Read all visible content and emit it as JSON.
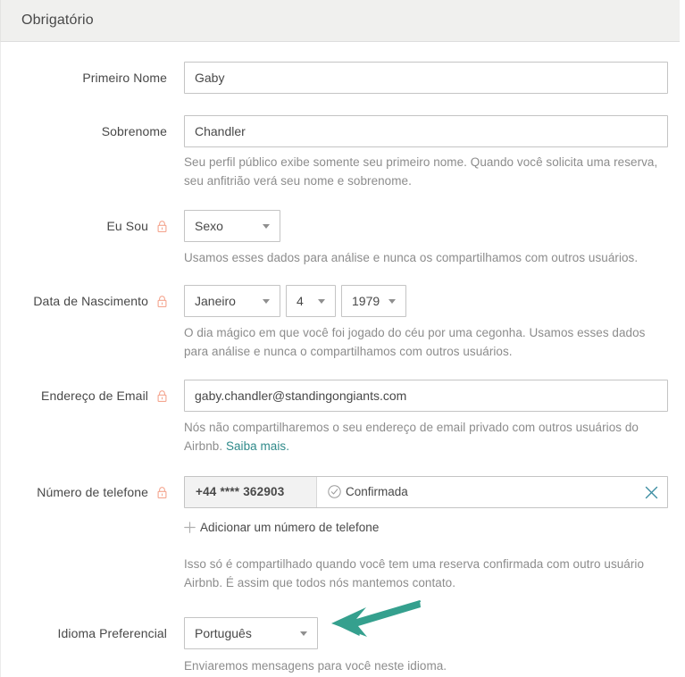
{
  "section": {
    "title": "Obrigatório"
  },
  "colors": {
    "header_bg": "#f0f0ee",
    "text": "#484848",
    "muted_text": "#8c8c8c",
    "link": "#2f8a8a",
    "lock_icon": "#f4a58f",
    "close_icon": "#3e8fa3",
    "annotation_arrow": "#35a08e",
    "input_border": "#c4c4c4"
  },
  "fields": {
    "first_name": {
      "label": "Primeiro Nome",
      "value": "Gaby",
      "locked": false
    },
    "last_name": {
      "label": "Sobrenome",
      "value": "Chandler",
      "locked": false,
      "help": "Seu perfil público exibe somente seu primeiro nome. Quando você solicita uma reserva, seu anfitrião verá seu nome e sobrenome."
    },
    "gender": {
      "label": "Eu Sou",
      "locked": true,
      "lock_icon": "lock-icon",
      "value": "Sexo",
      "help": "Usamos esses dados para análise e nunca os compartilhamos com outros usuários."
    },
    "birth_date": {
      "label": "Data de Nascimento",
      "locked": true,
      "lock_icon": "lock-icon",
      "month": "Janeiro",
      "day": "4",
      "year": "1979",
      "help": "O dia mágico em que você foi jogado do céu por uma cegonha. Usamos esses dados para análise e nunca o compartilhamos com outros usuários."
    },
    "email": {
      "label": "Endereço de Email",
      "locked": true,
      "lock_icon": "lock-icon",
      "value": "gaby.chandler@standingongiants.com",
      "help_prefix": "Nós não compartilharemos o seu endereço de email privado com outros usuários do Airbnb. ",
      "help_link": "Saiba mais."
    },
    "phone": {
      "label": "Número de telefone",
      "locked": true,
      "lock_icon": "lock-icon",
      "number": "+44 **** 362903",
      "status": "Confirmada",
      "status_icon": "check-circle-icon",
      "remove_icon": "close-icon",
      "add_label": "Adicionar um número de telefone",
      "add_icon": "plus-icon",
      "help": "Isso só é compartilhado quando você tem uma reserva confirmada com outro usuário Airbnb. É assim que todos nós mantemos contato."
    },
    "language": {
      "label": "Idioma Preferencial",
      "locked": false,
      "value": "Português",
      "help": "Enviaremos mensagens para você neste idioma."
    }
  },
  "annotation": {
    "type": "arrow",
    "points_to": "language-select"
  }
}
